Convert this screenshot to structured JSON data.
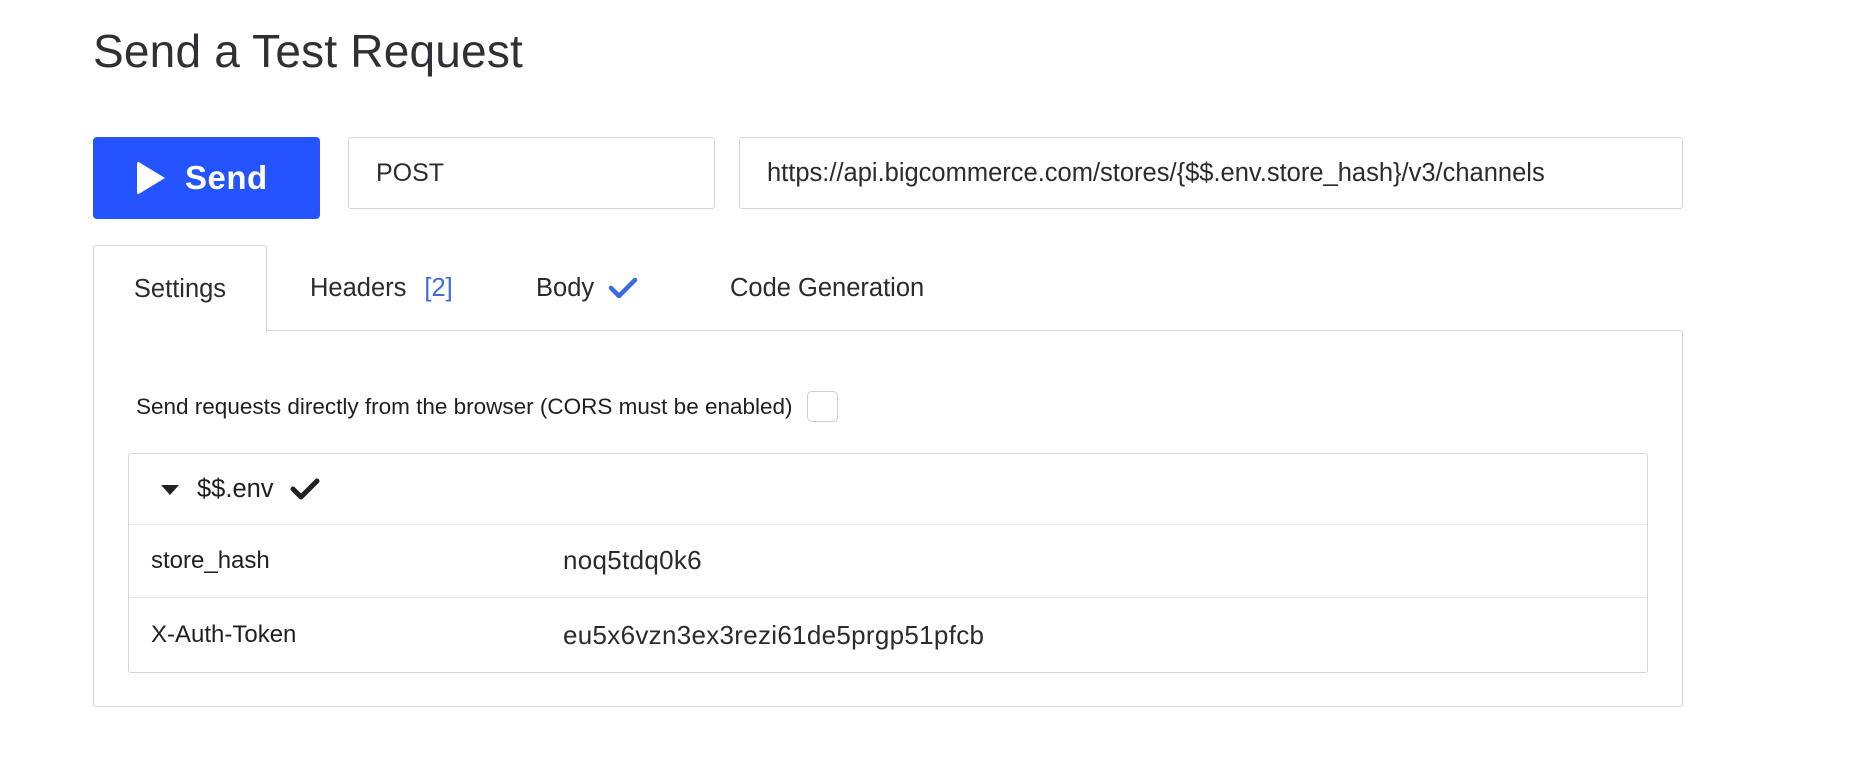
{
  "page": {
    "title": "Send a Test Request"
  },
  "toolbar": {
    "send_label": "Send",
    "method": "POST",
    "url": "https://api.bigcommerce.com/stores/{$$.env.store_hash}/v3/channels"
  },
  "tabs": [
    {
      "label": "Settings",
      "active": true
    },
    {
      "label": "Headers",
      "count": "[2]"
    },
    {
      "label": "Body",
      "icon": "check-icon"
    },
    {
      "label": "Code Generation"
    }
  ],
  "settings": {
    "cors_label": "Send requests directly from the browser (CORS must be enabled)",
    "cors_checked": false,
    "env": {
      "name": "$$.env",
      "expanded": true,
      "icon": "check-icon",
      "rows": [
        {
          "key": "store_hash",
          "value": "noq5tdq0k6"
        },
        {
          "key": "X-Auth-Token",
          "value": "eu5x6vzn3ex3rezi61de5prgp51pfcb"
        }
      ]
    }
  },
  "colors": {
    "primary": "#2454ff",
    "tab_accent": "#3d6ae0",
    "border": "#d6d6d6"
  }
}
